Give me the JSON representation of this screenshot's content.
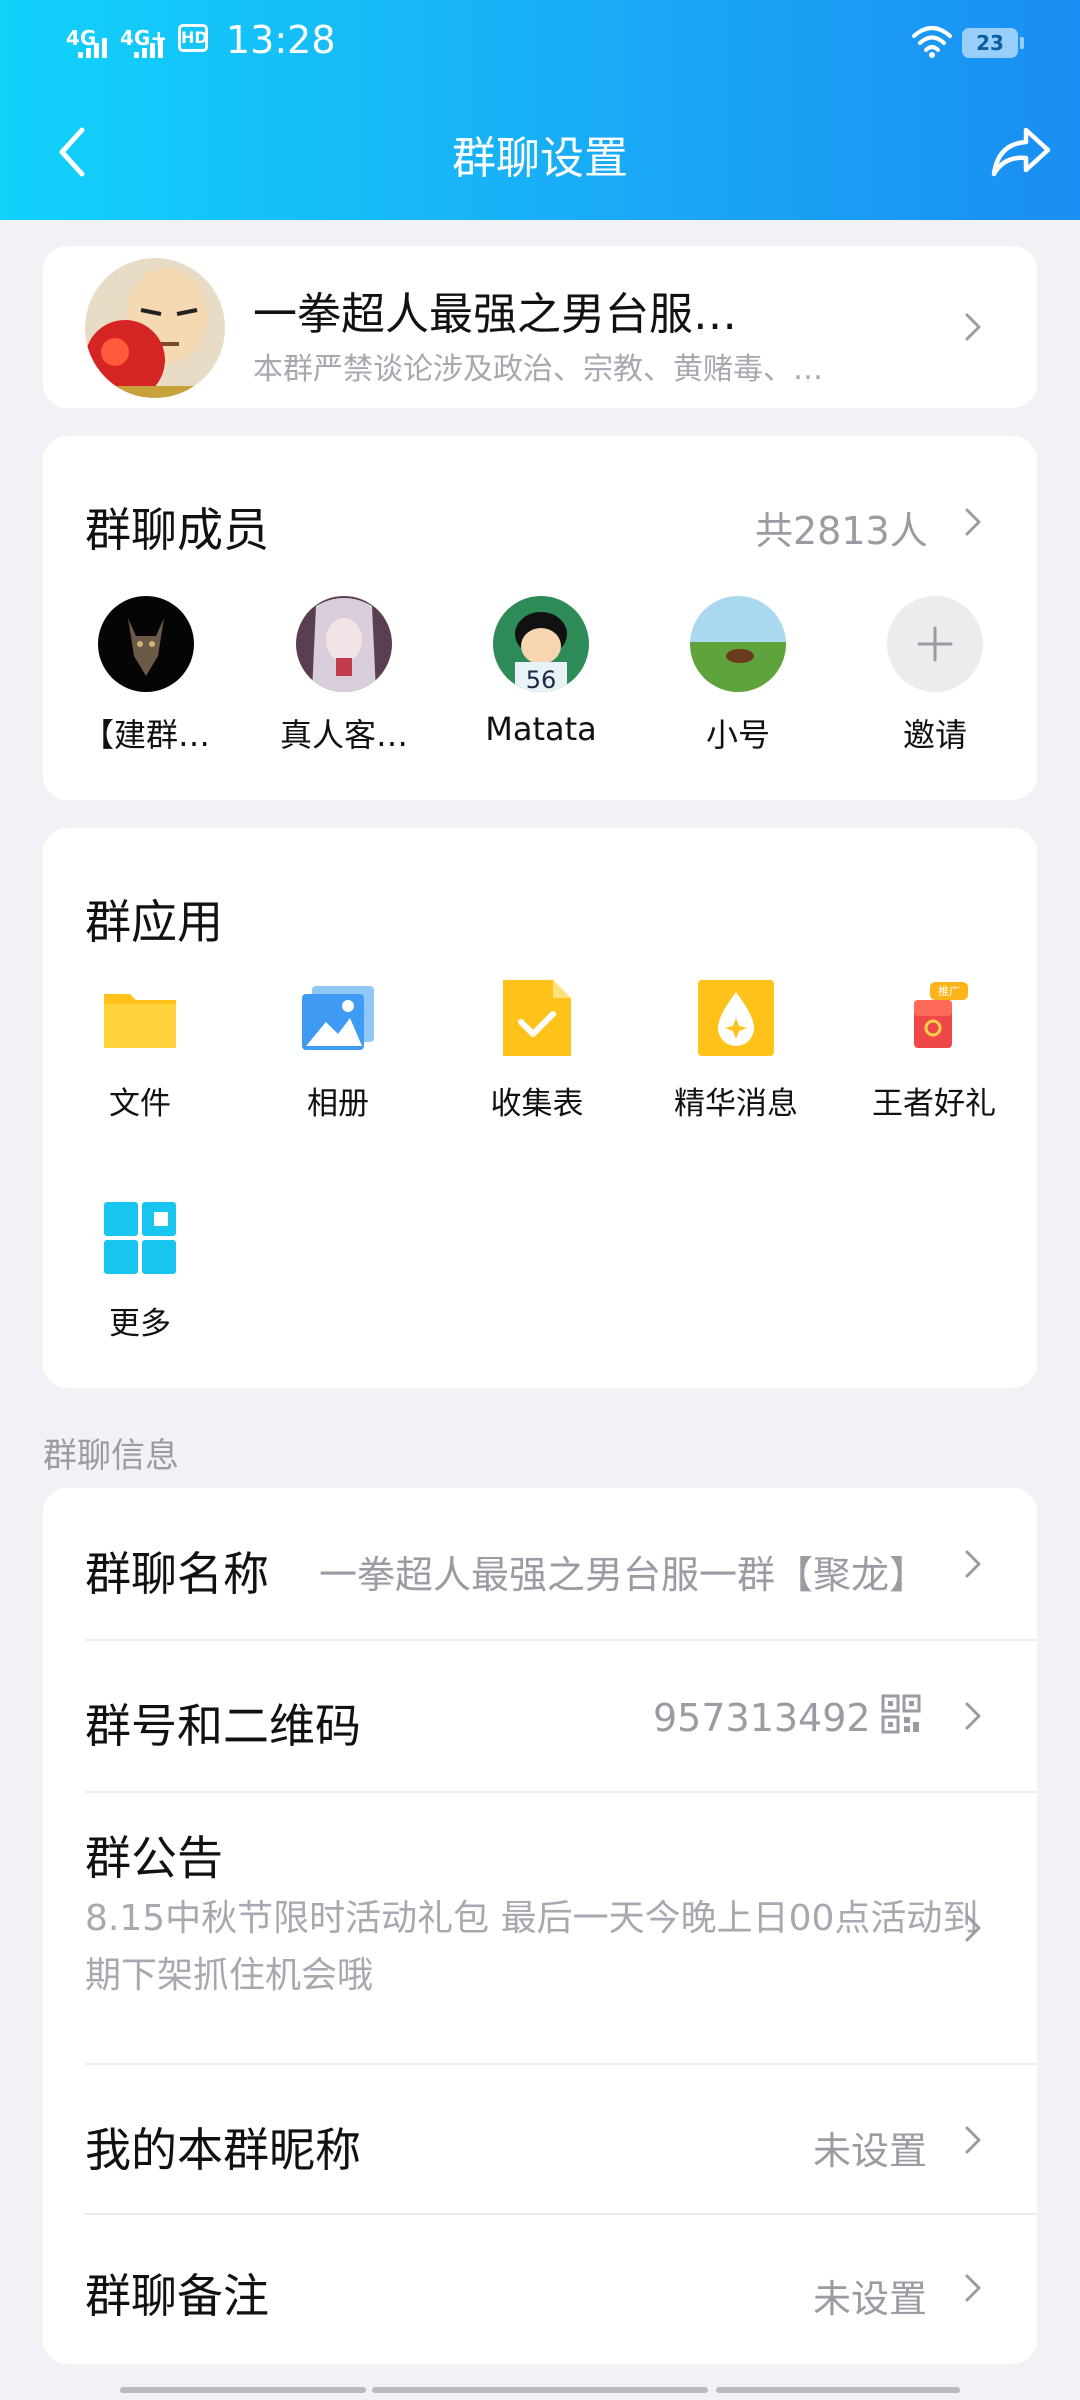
{
  "status_bar": {
    "signal1": "4G",
    "signal2": "4G+",
    "hd": "HD",
    "time": "13:28",
    "battery": "23"
  },
  "header": {
    "title": "群聊设置",
    "back_icon": "chevron-left-icon",
    "share_icon": "share-icon"
  },
  "group": {
    "name": "一拳超人最强之男台服…",
    "description": "本群严禁谈论涉及政治、宗教、黄赌毒、…"
  },
  "members": {
    "title": "群聊成员",
    "count": "共2813人",
    "items": [
      {
        "name": "【建群…"
      },
      {
        "name": "真人客…"
      },
      {
        "name": "Matata"
      },
      {
        "name": "小号"
      },
      {
        "name": "邀请"
      }
    ]
  },
  "apps": {
    "title": "群应用",
    "items": [
      {
        "label": "文件",
        "icon": "folder-icon"
      },
      {
        "label": "相册",
        "icon": "album-icon"
      },
      {
        "label": "收集表",
        "icon": "form-icon"
      },
      {
        "label": "精华消息",
        "icon": "essence-icon"
      },
      {
        "label": "王者好礼",
        "icon": "gift-icon",
        "badge": "推广"
      },
      {
        "label": "更多",
        "icon": "more-apps-icon"
      }
    ]
  },
  "info": {
    "section_label": "群聊信息",
    "group_name_label": "群聊名称",
    "group_name_value": "一拳超人最强之男台服一群【聚龙】",
    "group_id_label": "群号和二维码",
    "group_id_value": "957313492",
    "notice_label": "群公告",
    "notice_text": "8.15中秋节限时活动礼包  最后一天今晚上日00点活动到期下架抓住机会哦",
    "nickname_label": "我的本群昵称",
    "nickname_value": "未设置",
    "remark_label": "群聊备注",
    "remark_value": "未设置"
  },
  "colors": {
    "header_start": "#11d2fb",
    "header_end": "#1a8ef2",
    "background": "#f1f2f6"
  }
}
